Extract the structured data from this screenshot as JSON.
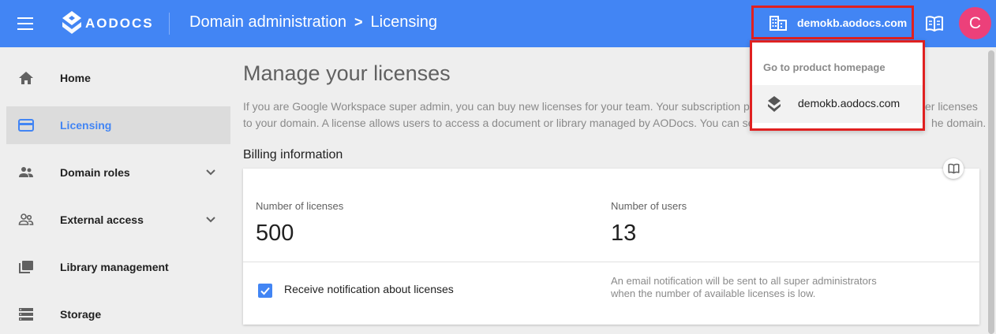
{
  "header": {
    "logo_text": "AODOCS",
    "breadcrumb_parent": "Domain administration",
    "breadcrumb_separator": ">",
    "breadcrumb_current": "Licensing",
    "domain_label": "demokb.aodocs.com",
    "avatar_letter": "C",
    "accent": "#4285f4",
    "avatar_color": "#ec407a"
  },
  "sidebar": {
    "items": [
      {
        "label": "Home",
        "icon": "home-icon"
      },
      {
        "label": "Licensing",
        "icon": "credit-card-icon",
        "active": true
      },
      {
        "label": "Domain roles",
        "icon": "people-icon",
        "expandable": true
      },
      {
        "label": "External access",
        "icon": "people-outline-icon",
        "expandable": true
      },
      {
        "label": "Library management",
        "icon": "library-icon"
      },
      {
        "label": "Storage",
        "icon": "storage-icon"
      }
    ]
  },
  "main": {
    "title": "Manage your licenses",
    "intro_line1": "If you are Google Workspace super admin, you can buy new licenses for your team. Your subscription pl",
    "intro_line1_end": "er licenses",
    "intro_line2": "to your domain. A license allows users to access a document or library managed by AODocs. You can se",
    "intro_line2_end": "he domain.",
    "billing_title": "Billing information",
    "licenses_label": "Number of licenses",
    "licenses_value": "500",
    "users_label": "Number of users",
    "users_value": "13",
    "notification_label": "Receive notification about licenses",
    "notification_checked": true,
    "notification_help": "An email notification will be sent to all super administrators when the number of available licenses is low."
  },
  "dropdown": {
    "heading": "Go to product homepage",
    "item_label": "demokb.aodocs.com"
  }
}
